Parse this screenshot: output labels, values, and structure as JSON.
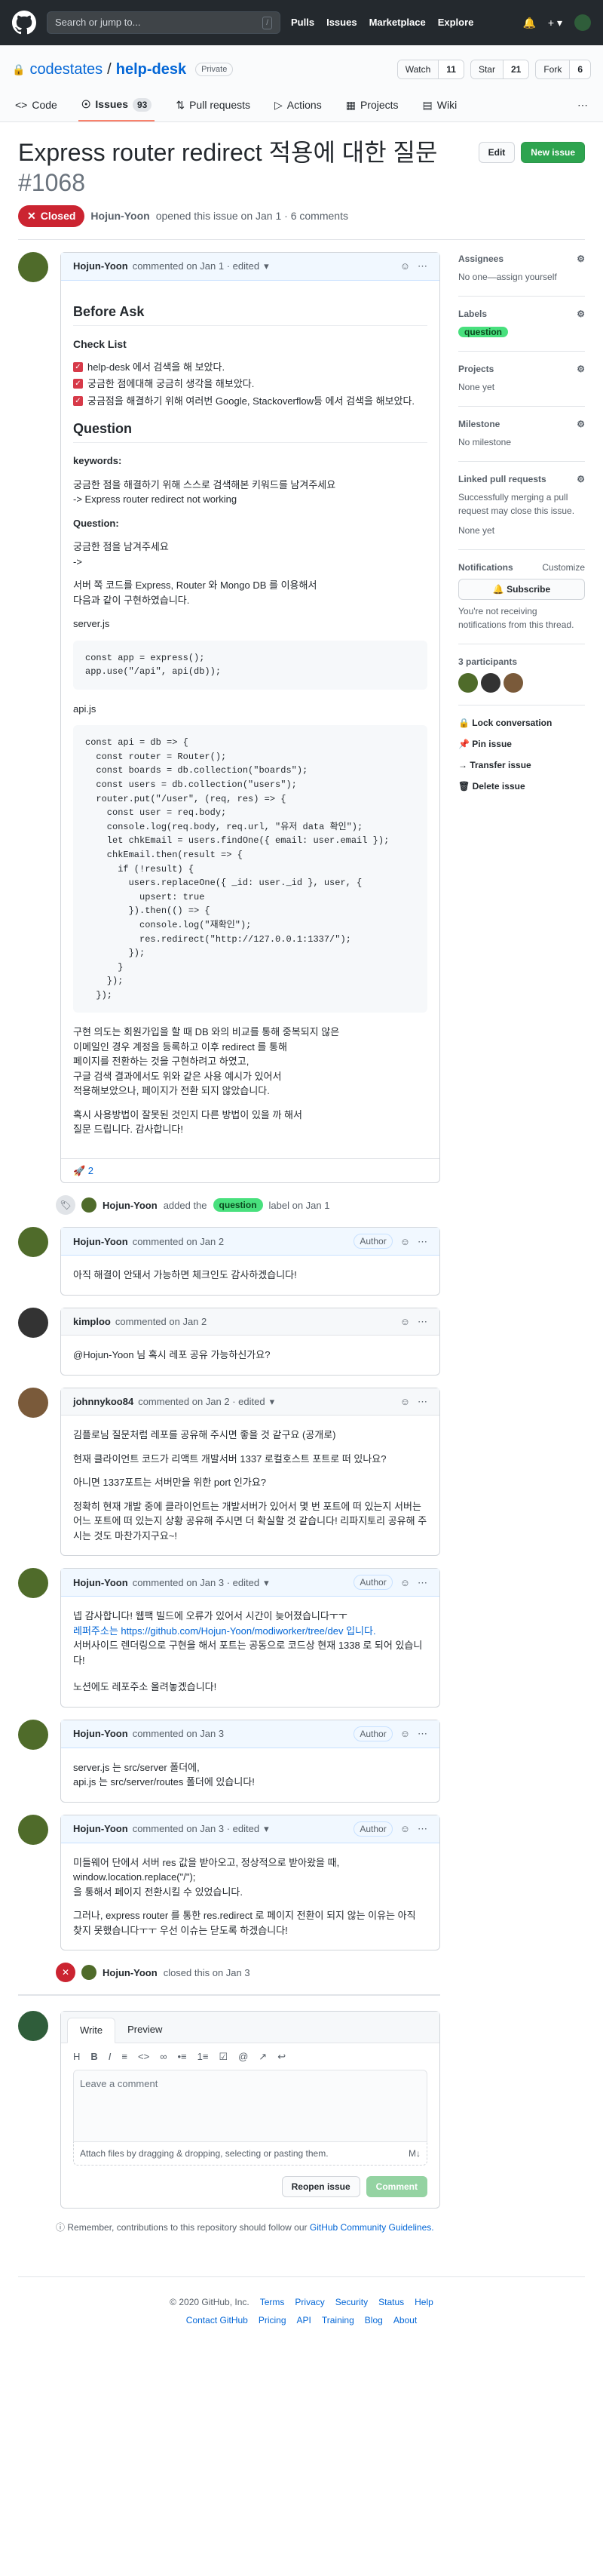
{
  "header": {
    "search_placeholder": "Search or jump to...",
    "slash": "/",
    "nav": [
      "Pulls",
      "Issues",
      "Marketplace",
      "Explore"
    ]
  },
  "repo": {
    "owner": "codestates",
    "sep": "/",
    "name": "help-desk",
    "visibility": "Private",
    "watch": "Watch",
    "watch_count": "11",
    "star": "Star",
    "star_count": "21",
    "fork": "Fork",
    "fork_count": "6"
  },
  "tabs": [
    {
      "label": "Code"
    },
    {
      "label": "Issues",
      "count": "93"
    },
    {
      "label": "Pull requests"
    },
    {
      "label": "Actions"
    },
    {
      "label": "Projects"
    },
    {
      "label": "Wiki"
    }
  ],
  "issue": {
    "title": "Express router redirect 적용에 대한 질문",
    "number": "#1068",
    "state": "Closed",
    "author": "Hojun-Yoon",
    "meta": "opened this issue on Jan 1 · 6 comments",
    "edit": "Edit",
    "new": "New issue"
  },
  "first": {
    "author": "Hojun-Yoon",
    "when": "commented on Jan 1 · edited",
    "h_before": "Before Ask",
    "h_check": "Check List",
    "checks": [
      "help-desk 에서 검색을 해 보았다.",
      "궁금한 점에대해 궁금히 생각을 해보았다.",
      "궁금점을 해결하기 위해 여러번 Google, Stackoverflow등 에서 검색을 해보았다."
    ],
    "h_q": "Question",
    "kw": "keywords:",
    "kw1": "궁금한 점을 해결하기 위해 스스로 검색해본 키워드를 남겨주세요",
    "kw2": "-> Express router redirect not working",
    "qlabel": "Question:",
    "q1": "궁금한 점을 남겨주세요",
    "q2": "->",
    "q3": "서버 쪽 코드를 Express, Router 와 Mongo DB 를 이용해서",
    "q4": "다음과 같이 구현하였습니다.",
    "f1": "server.js",
    "code1": "const app = express();\napp.use(\"/api\", api(db));",
    "f2": "api.js",
    "code2": "const api = db => {\n  const router = Router();\n  const boards = db.collection(\"boards\");\n  const users = db.collection(\"users\");\n  router.put(\"/user\", (req, res) => {\n    const user = req.body;\n    console.log(req.body, req.url, \"유저 data 확인\");\n    let chkEmail = users.findOne({ email: user.email });\n    chkEmail.then(result => {\n      if (!result) {\n        users.replaceOne({ _id: user._id }, user, {\n          upsert: true\n        }).then(() => {\n          console.log(\"재확인\");\n          res.redirect(\"http://127.0.0.1:1337/\");\n        });\n      }\n    });\n  });",
    "p1": "구현 의도는 회원가입을 할 때 DB 와의 비교를 통해 중복되지 않은",
    "p2": "이메일인 경우 계정을 등록하고 이후 redirect 를 통해",
    "p3": "페이지를 전환하는 것을 구현하려고 하였고,",
    "p4": "구글 검색 결과에서도 위와 같은 사용 예시가 있어서",
    "p5": "적용해보았으나, 페이지가 전환 되지 않았습니다.",
    "p6": "혹시 사용방법이 잘못된 것인지 다른 방법이 있을 까 해서",
    "p7": "질문 드립니다. 감사합니다!",
    "reaction": "🚀 2"
  },
  "ev_label": {
    "author": "Hojun-Yoon",
    "text": "added the",
    "label": "question",
    "tail": "label on Jan 1"
  },
  "comments": [
    {
      "author": "Hojun-Yoon",
      "when": "commented on Jan 2",
      "role": "Author",
      "lines": [
        "아직 해결이 안돼서 가능하면 체크인도 감사하겠습니다!"
      ]
    },
    {
      "author": "kimploo",
      "when": "commented on Jan 2",
      "role": "",
      "lines": [
        "@Hojun-Yoon 님 혹시 레포 공유 가능하신가요?"
      ]
    },
    {
      "author": "johnnykoo84",
      "when": "commented on Jan 2 · edited",
      "role": "",
      "lines": [
        "김플로님 질문처럼 레포를 공유해 주시면 좋을 것 같구요 (공개로)",
        "현재 클라이언트 코드가 리액트 개발서버 1337 로컬호스트 포트로 떠 있나요?",
        "아니면 1337포트는 서버만을 위한 port 인가요?",
        "정확히 현재 개발 중에 클라이언트는 개발서버가 있어서 몇 번 포트에 떠 있는지 서버는 어느 포트에 떠 있는지 상황 공유해 주시면 더 확실할 것 같습니다! 리파지토리 공유해 주시는 것도 마찬가지구요~!"
      ]
    },
    {
      "author": "Hojun-Yoon",
      "when": "commented on Jan 3 · edited",
      "role": "Author",
      "lines": [
        "넵 감사합니다! 웹팩 빌드에 오류가 있어서 시간이 늦어졌습니다ㅜㅜ",
        "레퍼주소는 https://github.com/Hojun-Yoon/modiworker/tree/dev 입니다.",
        "서버사이드 렌더링으로 구현을 해서 포트는 공동으로 코드상 현재 1338 로 되어 있습니다!",
        "노션에도 레포주소 올려놓겠습니다!"
      ]
    },
    {
      "author": "Hojun-Yoon",
      "when": "commented on Jan 3",
      "role": "Author",
      "lines": [
        "server.js 는 src/server 폴더에,",
        "api.js 는 src/server/routes 폴더에 있습니다!"
      ]
    },
    {
      "author": "Hojun-Yoon",
      "when": "commented on Jan 3 · edited",
      "role": "Author",
      "lines": [
        "미들웨어 단에서 서버 res 값을 받아오고, 정상적으로 받아왔을 때,",
        "window.location.replace(\"/\");",
        "을 통해서 페이지 전환시킬 수 있었습니다.",
        "그러나, express router 를 통한 res.redirect 로 페이지 전환이 되지 않는 이유는 아직 찾지 못했습니다ㅜㅜ 우선 이슈는 닫도록 하겠습니다!"
      ]
    }
  ],
  "ev_close": {
    "author": "Hojun-Yoon",
    "text": "closed this on Jan 3"
  },
  "form": {
    "write": "Write",
    "preview": "Preview",
    "placeholder": "Leave a comment",
    "attach": "Attach files by dragging & dropping, selecting or pasting them.",
    "md": "M↓",
    "reopen": "Reopen issue",
    "comment": "Comment",
    "note": "Remember, contributions to this repository should follow our",
    "note_link": "GitHub Community Guidelines."
  },
  "sidebar": {
    "assignees": "Assignees",
    "assignees_v": "No one—assign yourself",
    "labels": "Labels",
    "label": "question",
    "projects": "Projects",
    "projects_v": "None yet",
    "milestone": "Milestone",
    "milestone_v": "No milestone",
    "linked": "Linked pull requests",
    "linked_d": "Successfully merging a pull request may close this issue.",
    "linked_v": "None yet",
    "notif": "Notifications",
    "customize": "Customize",
    "subscribe": "Subscribe",
    "notif_d": "You're not receiving notifications from this thread.",
    "participants": "3 participants",
    "lock": "Lock conversation",
    "pin": "Pin issue",
    "transfer": "Transfer issue",
    "delete": "Delete issue"
  },
  "footer": {
    "copy": "© 2020 GitHub, Inc.",
    "row1": [
      "Terms",
      "Privacy",
      "Security",
      "Status",
      "Help"
    ],
    "row2": [
      "Contact GitHub",
      "Pricing",
      "API",
      "Training",
      "Blog",
      "About"
    ]
  }
}
